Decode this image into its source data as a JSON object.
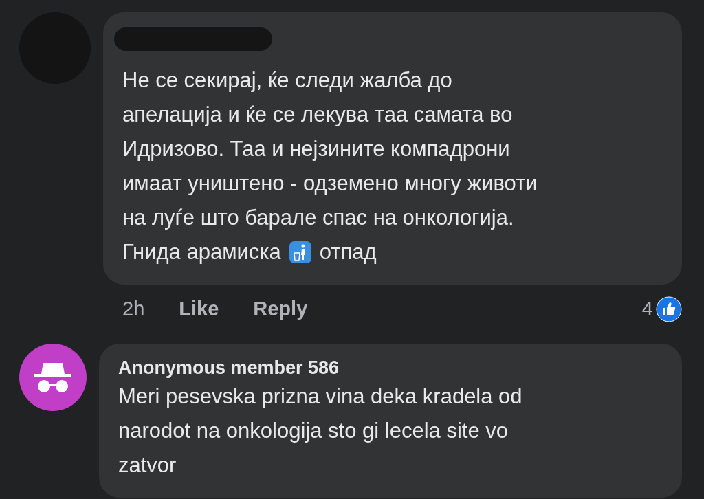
{
  "comments": [
    {
      "avatar": {
        "kind": "redacted"
      },
      "text": "Не се секирај, ќе следи жалба до\nапелација и ќе се лекува таа самата во\nИдризово. Таа и нејзините компадрони\nимаат уништено - одземено многу животи\nна луѓе што барале спас на онкологија.",
      "text_before_icon": "Гнида арамиска",
      "text_after_icon": "отпад",
      "time": "2h",
      "actions": [
        "Like",
        "Reply"
      ],
      "reaction_count": "4"
    },
    {
      "author": "Anonymous member 586",
      "avatar": {
        "kind": "anonymous"
      },
      "text": "Meri pesevska prizna vina deka kradela od\nnarodot na onkologija sto gi lecela site vo\nzatvor"
    }
  ]
}
